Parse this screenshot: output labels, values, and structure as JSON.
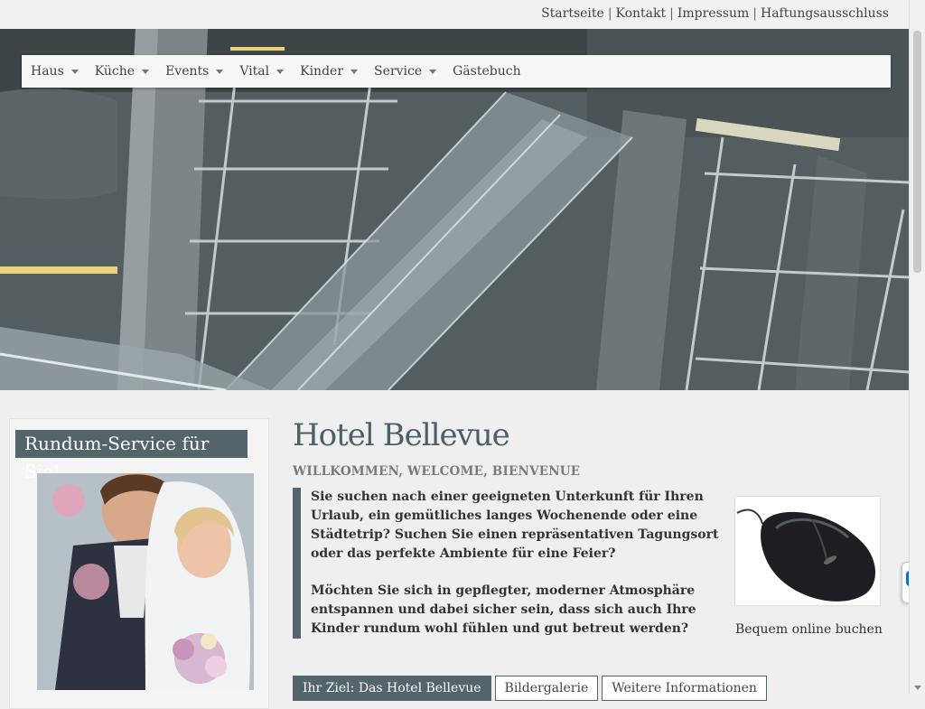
{
  "toplinks": {
    "items": [
      "Startseite",
      "Kontakt",
      "Impressum",
      "Haftungsausschluss"
    ],
    "separator": "|"
  },
  "nav": {
    "items": [
      {
        "label": "Haus",
        "dropdown": true
      },
      {
        "label": "Küche",
        "dropdown": true
      },
      {
        "label": "Events",
        "dropdown": true
      },
      {
        "label": "Vital",
        "dropdown": true
      },
      {
        "label": "Kinder",
        "dropdown": true
      },
      {
        "label": "Service",
        "dropdown": true
      },
      {
        "label": "Gästebuch",
        "dropdown": false
      }
    ]
  },
  "sidebar": {
    "heading": "Rundum-Service für Sie!"
  },
  "main": {
    "title": "Hotel Bellevue",
    "subtitle": "WILLKOMMEN, WELCOME, BIENVENUE",
    "paragraph1": "Sie suchen nach einer geeigneten Unterkunft für Ihren Urlaub, ein gemütliches langes Wochenende oder eine Städtetrip? Suchen Sie einen repräsentativen Tagungsort oder das perfekte Ambiente für eine Feier?",
    "paragraph2": "Möchten Sie sich in gepflegter, moderner Atmosphäre entspannen und dabei sicher sein, dass sich auch Ihre Kinder rundum wohl fühlen und gut betreut werden?",
    "product_caption": "Bequem online buchen"
  },
  "tabs": [
    {
      "label": "Ihr Ziel: Das Hotel Bellevue",
      "active": true
    },
    {
      "label": "Bildergalerie",
      "active": false
    },
    {
      "label": "Weitere Informationen",
      "active": false
    }
  ],
  "colors": {
    "accent": "#53646a",
    "title": "#4d5f66",
    "background": "#efefef"
  }
}
